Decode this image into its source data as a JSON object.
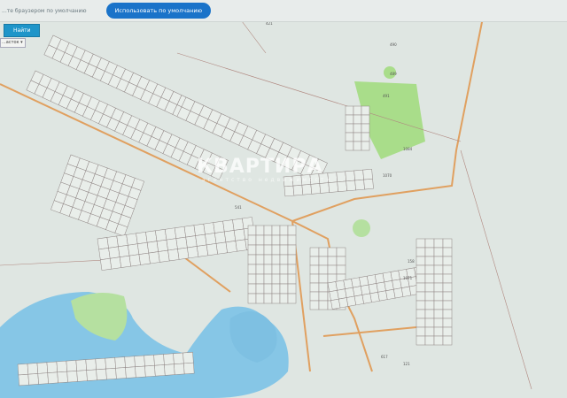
{
  "browser_bar": {
    "message": "...те браузером по умолчанию",
    "default_button": "Использовать по умолчанию"
  },
  "search": {
    "find_button": "Найти",
    "type_select": "...асток"
  },
  "watermark": {
    "title": "КВАРТИРА",
    "subtitle": "агентство недвижимости"
  },
  "map": {
    "colors": {
      "background": "#dfe6e2",
      "parcel_border": "#9a8a86",
      "road": "#e0a060",
      "water": "#7fc4e6",
      "green": "#a9dd8a"
    },
    "labels": [
      "421",
      "490",
      "489",
      "491",
      "1084",
      "1070",
      "541",
      "158",
      "1071",
      "121",
      "617"
    ]
  }
}
